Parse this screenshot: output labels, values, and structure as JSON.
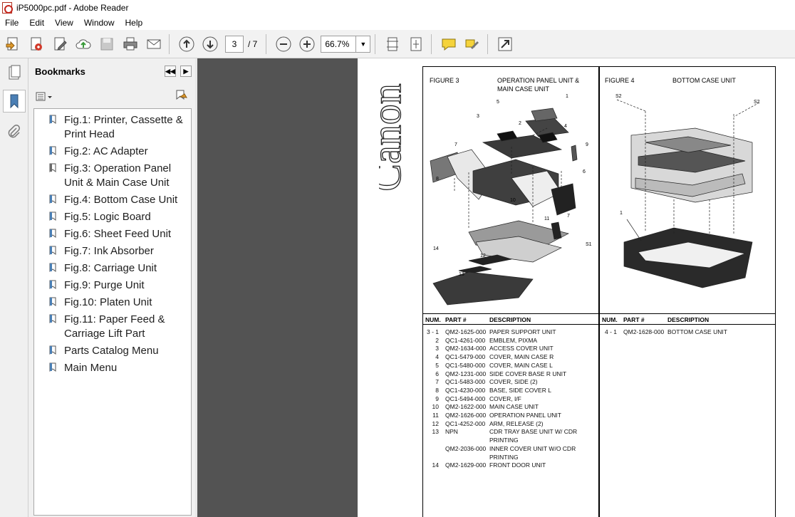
{
  "window": {
    "title": "iP5000pc.pdf - Adobe Reader"
  },
  "menu": [
    "File",
    "Edit",
    "View",
    "Window",
    "Help"
  ],
  "toolbar": {
    "page_current": "3",
    "page_total": "/ 7",
    "zoom": "66.7%"
  },
  "sidebar": {
    "title": "Bookmarks",
    "bookmarks": [
      {
        "label": "Fig.1: Printer, Cassette & Print Head"
      },
      {
        "label": "Fig.2: AC Adapter"
      },
      {
        "label": "Fig.3: Operation Panel Unit & Main Case Unit"
      },
      {
        "label": "Fig.4: Bottom Case Unit"
      },
      {
        "label": "Fig.5: Logic Board"
      },
      {
        "label": "Fig.6: Sheet Feed Unit"
      },
      {
        "label": "Fig.7: Ink Absorber"
      },
      {
        "label": "Fig.8: Carriage Unit"
      },
      {
        "label": "Fig.9: Purge Unit"
      },
      {
        "label": "Fig.10: Platen Unit"
      },
      {
        "label": "Fig.11: Paper Feed & Carriage Lift Part"
      },
      {
        "label": "Parts Catalog Menu"
      },
      {
        "label": "Main Menu"
      }
    ]
  },
  "document": {
    "logo_text": "Canon",
    "figure3": {
      "label": "FIGURE 3",
      "title_line1": "OPERATION PANEL UNIT &",
      "title_line2": "MAIN CASE UNIT",
      "callouts": [
        "1",
        "2",
        "3",
        "4",
        "5",
        "6",
        "7",
        "8",
        "9",
        "10",
        "11",
        "12",
        "13",
        "14",
        "7",
        "S1"
      ],
      "headers": {
        "num": "NUM.",
        "part": "PART #",
        "desc": "DESCRIPTION"
      },
      "rows": [
        {
          "num": "3 - 1",
          "part": "QM2-1625-000",
          "desc": "PAPER SUPPORT UNIT"
        },
        {
          "num": "2",
          "part": "QC1-4261-000",
          "desc": "EMBLEM, PIXMA"
        },
        {
          "num": "3",
          "part": "QM2-1634-000",
          "desc": "ACCESS COVER UNIT"
        },
        {
          "num": "4",
          "part": "QC1-5479-000",
          "desc": "COVER, MAIN CASE R"
        },
        {
          "num": "5",
          "part": "QC1-5480-000",
          "desc": "COVER, MAIN CASE L"
        },
        {
          "num": "6",
          "part": "QM2-1231-000",
          "desc": "SIDE COVER BASE R UNIT"
        },
        {
          "num": "7",
          "part": "QC1-5483-000",
          "desc": "COVER, SIDE (2)"
        },
        {
          "num": "8",
          "part": "QC1-4230-000",
          "desc": "BASE, SIDE COVER L"
        },
        {
          "num": "9",
          "part": "QC1-5494-000",
          "desc": "COVER, I/F"
        },
        {
          "num": "10",
          "part": "QM2-1622-000",
          "desc": "MAIN CASE UNIT"
        },
        {
          "num": "11",
          "part": "QM2-1626-000",
          "desc": "OPERATION PANEL UNIT"
        },
        {
          "num": "12",
          "part": "QC1-4252-000",
          "desc": "ARM, RELEASE (2)"
        },
        {
          "num": "13",
          "part": "NPN",
          "desc": "CDR TRAY BASE UNIT W/ CDR"
        },
        {
          "num": "",
          "part": "",
          "desc": "PRINTING"
        },
        {
          "num": "",
          "part": "QM2-2036-000",
          "desc": "INNER COVER UNIT W/O CDR"
        },
        {
          "num": "",
          "part": "",
          "desc": "PRINTING"
        },
        {
          "num": "14",
          "part": "QM2-1629-000",
          "desc": "FRONT DOOR UNIT"
        }
      ]
    },
    "figure4": {
      "label": "FIGURE 4",
      "title": "BOTTOM CASE UNIT",
      "callouts": [
        "S2",
        "S2",
        "1"
      ],
      "headers": {
        "num": "NUM.",
        "part": "PART #",
        "desc": "DESCRIPTION"
      },
      "rows": [
        {
          "num": "4 - 1",
          "part": "QM2-1628-000",
          "desc": "BOTTOM CASE UNIT"
        }
      ]
    }
  }
}
